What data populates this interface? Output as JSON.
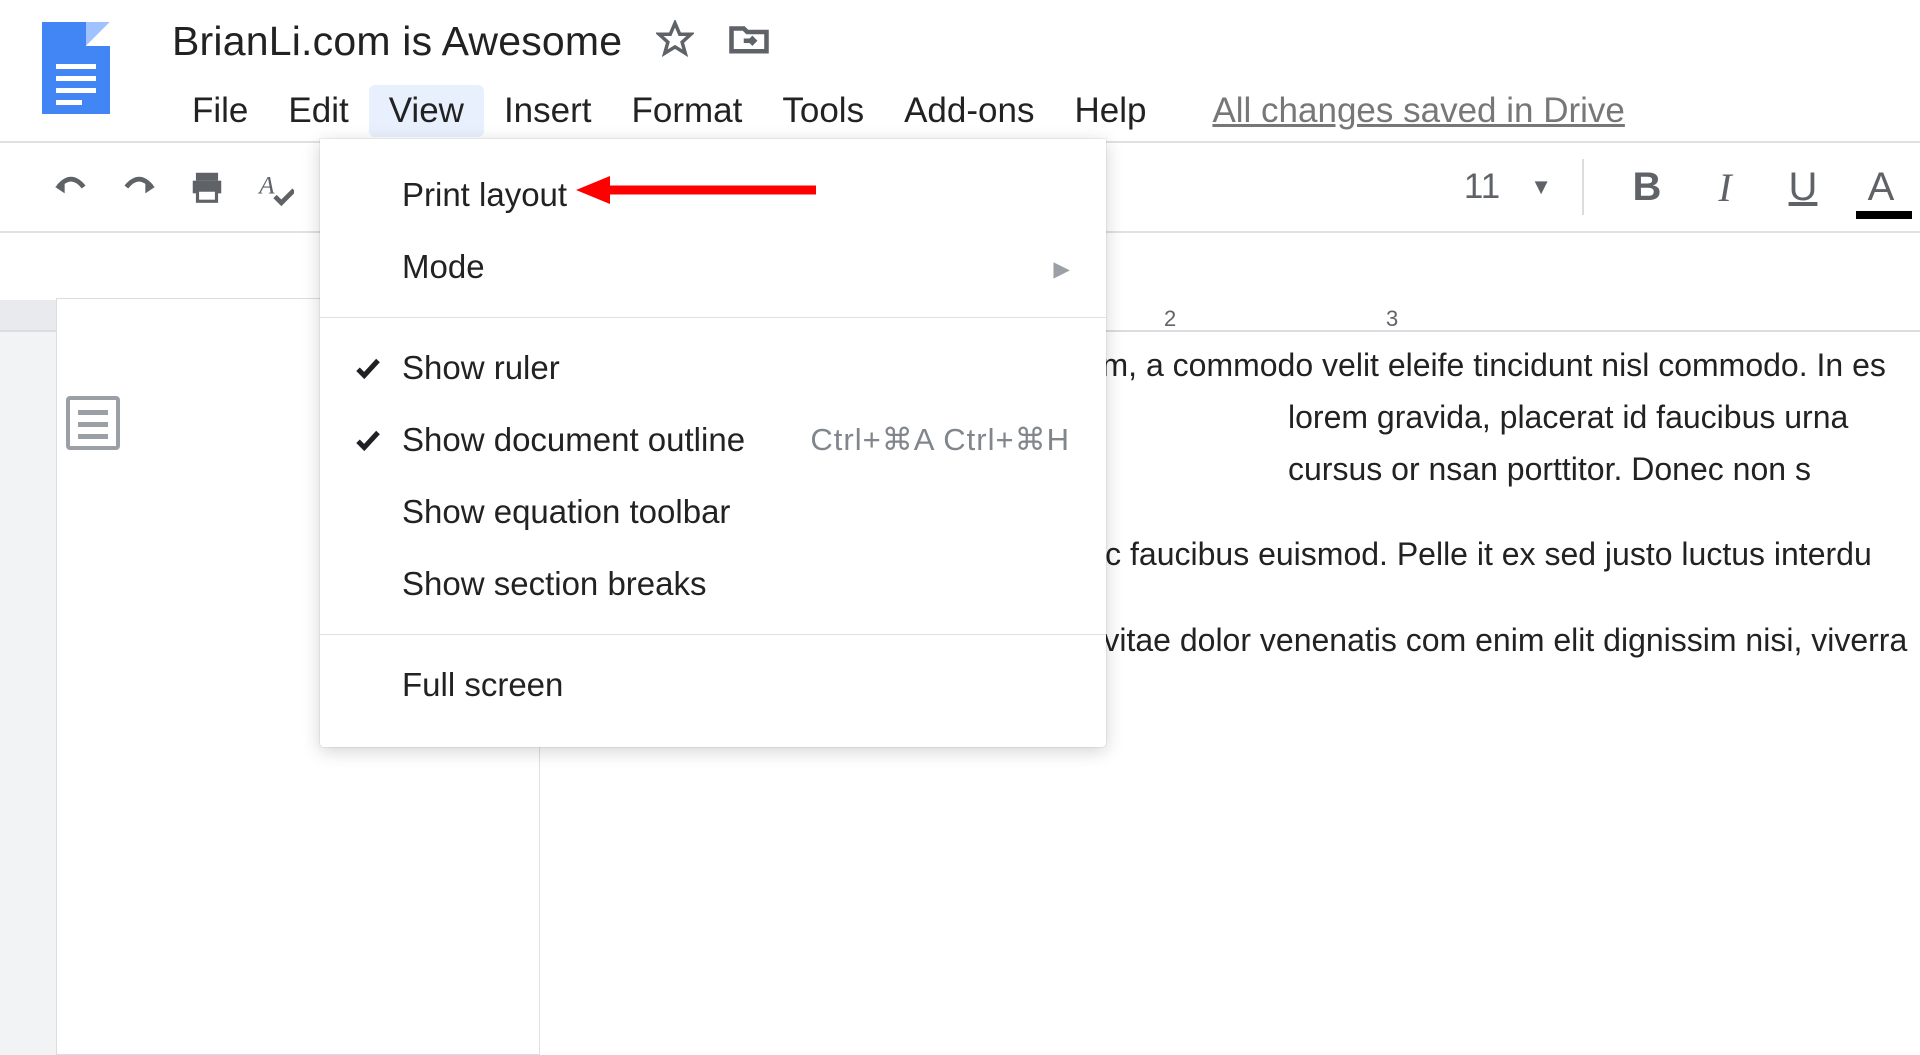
{
  "header": {
    "doc_title": "BrianLi.com is Awesome"
  },
  "menu": {
    "items": [
      "File",
      "Edit",
      "View",
      "Insert",
      "Format",
      "Tools",
      "Add-ons",
      "Help"
    ],
    "active_index": 2,
    "saved_msg": "All changes saved in Drive"
  },
  "toolbar": {
    "font_size": "11"
  },
  "ruler": {
    "marks": [
      "2",
      "3"
    ]
  },
  "dropdown": {
    "groups": [
      [
        {
          "label": "Print layout",
          "checked": false
        },
        {
          "label": "Mode",
          "submenu": true
        }
      ],
      [
        {
          "label": "Show ruler",
          "checked": true
        },
        {
          "label": "Show document outline",
          "checked": true,
          "shortcut": "Ctrl+⌘A Ctrl+⌘H"
        },
        {
          "label": "Show equation toolbar"
        },
        {
          "label": "Show section breaks"
        }
      ],
      [
        {
          "label": "Full screen"
        }
      ]
    ]
  },
  "document": {
    "para1": ". Curabitur gravida finibus m, a commodo velit eleife tincidunt nisl commodo. In es lorem gravida, placerat id faucibus urna cursus or nsan porttitor. Donec non s",
    "para2": "t nec sodales. Etiam ege ac faucibus euismod. Pelle it ex sed justo luctus interdu",
    "para3": "Pellentesque posuere nisi vitae dolor venenatis com enim elit dignissim nisi, viverra tincidunt justo dolo"
  },
  "format": {
    "bold": "B",
    "italic": "I",
    "underline": "U",
    "textcolor": "A"
  }
}
